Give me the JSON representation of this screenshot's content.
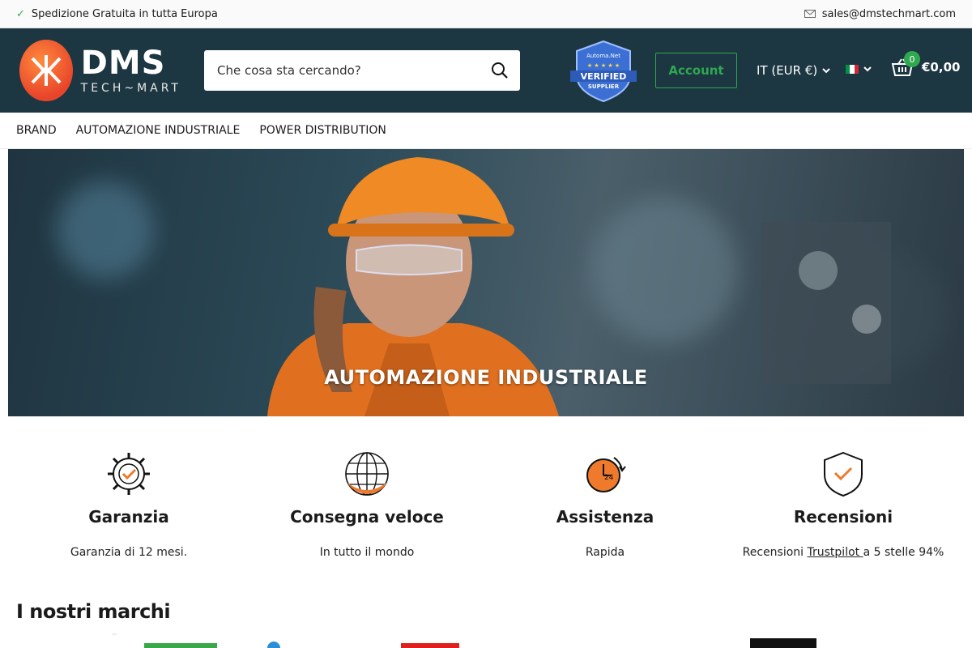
{
  "topbar": {
    "shipping": "Spedizione Gratuita in tutta Europa",
    "email": "sales@dmstechmart.com"
  },
  "header": {
    "logo_big": "DMS",
    "logo_small": "TECH~MART",
    "search_placeholder": "Che cosa sta cercando?",
    "badge_top": "Automa.Net",
    "badge_main": "VERIFIED",
    "badge_sub": "SUPPLIER",
    "account_label": "Account",
    "currency_label": "IT (EUR €)",
    "cart_count": "0",
    "cart_total": "€0,00"
  },
  "nav": {
    "items": [
      "BRAND",
      "AUTOMAZIONE INDUSTRIALE",
      "POWER DISTRIBUTION"
    ]
  },
  "hero": {
    "title": "AUTOMAZIONE INDUSTRIALE"
  },
  "features": [
    {
      "title": "Garanzia",
      "text": "Garanzia di 12 mesi.",
      "icon": "gear-check-icon"
    },
    {
      "title": "Consegna veloce",
      "text": "In tutto il mondo",
      "icon": "globe-icon"
    },
    {
      "title": "Assistenza",
      "text": "Rapida",
      "icon": "clock-24-icon"
    },
    {
      "title": "Recensioni",
      "text_pre": "Recensioni ",
      "link": "Trustpilot ",
      "text_post": "a 5 stelle 94%",
      "icon": "shield-check-icon"
    }
  ],
  "brands": {
    "title": "I nostri marchi"
  },
  "colors": {
    "header_bg": "#1c3642",
    "accent_green": "#2fa84f",
    "accent_orange": "#f07a2c"
  }
}
